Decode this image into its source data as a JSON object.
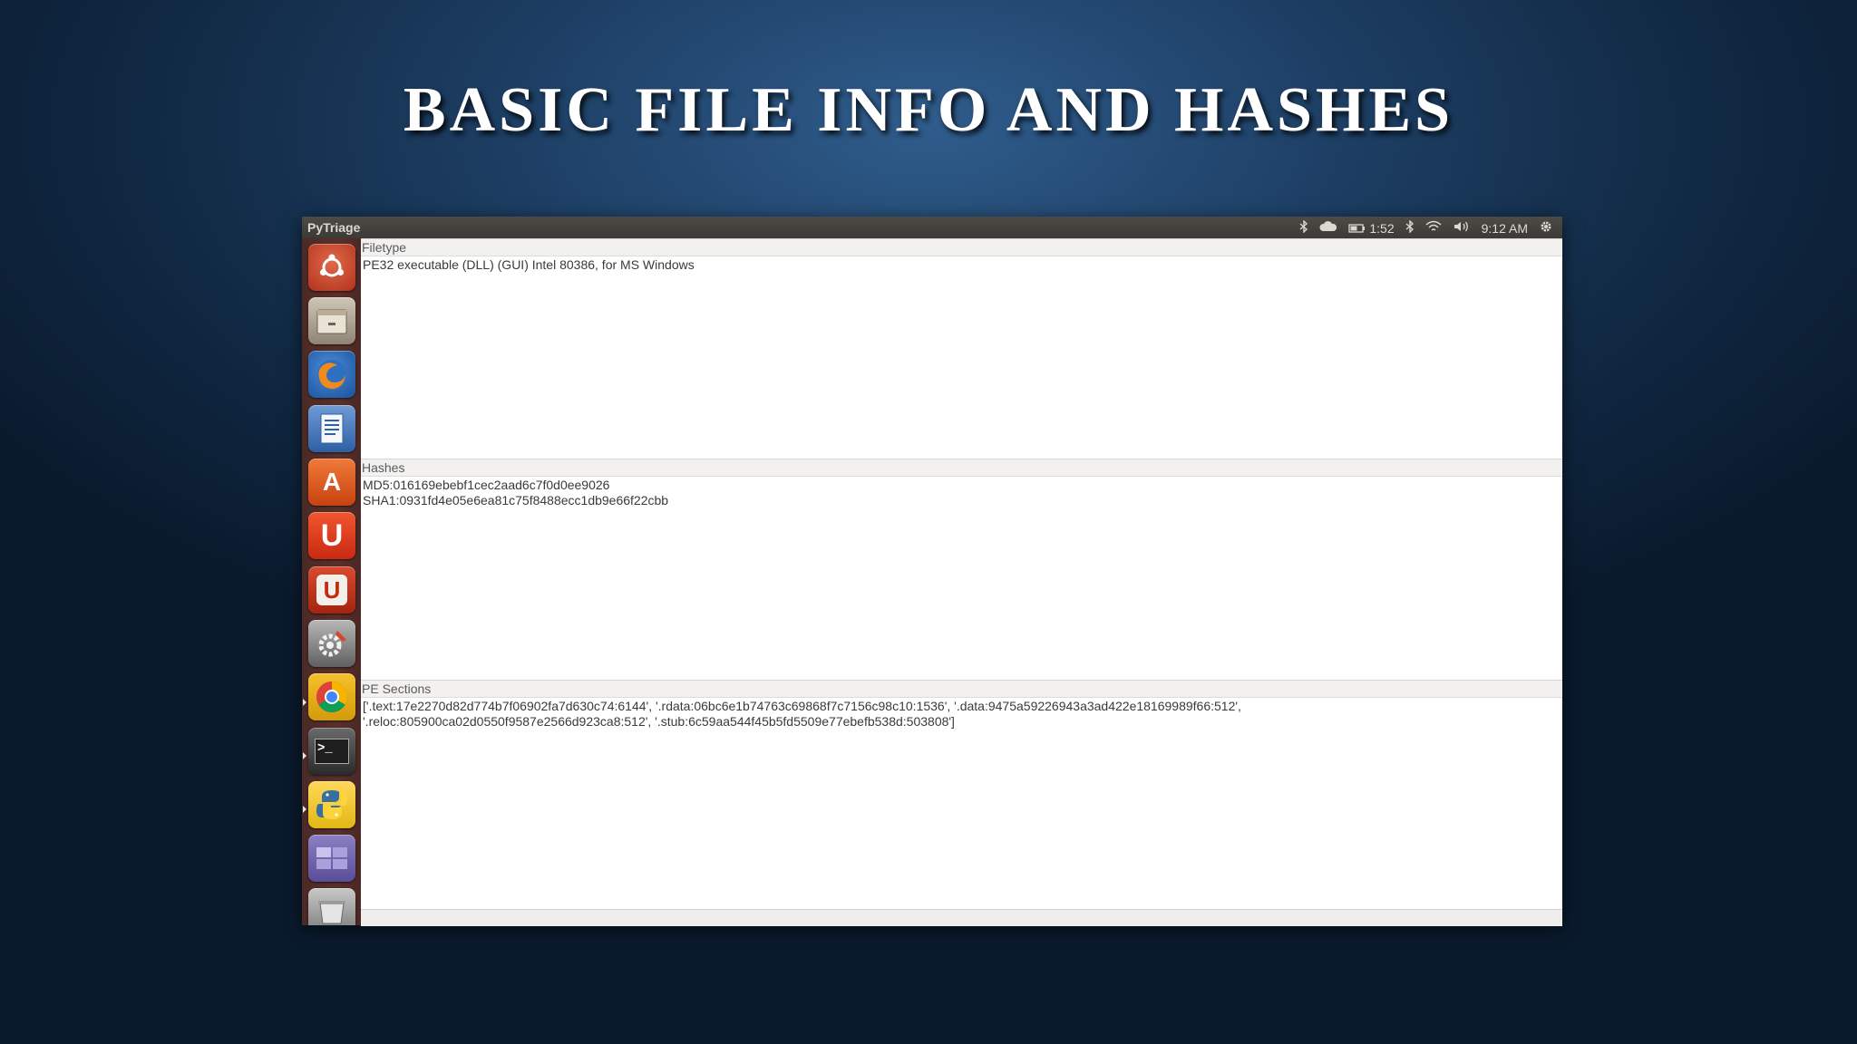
{
  "slide": {
    "title": "BASIC FILE INFO AND HASHES"
  },
  "topbar": {
    "app_name": "PyTriage",
    "battery_time": "1:52",
    "clock": "9:12 AM"
  },
  "launcher": {
    "items": [
      {
        "name": "ubuntu-dash-icon",
        "color": "#c9442a"
      },
      {
        "name": "files-icon",
        "color": "#9a8f7e"
      },
      {
        "name": "firefox-icon",
        "color": "#1b4f9c"
      },
      {
        "name": "writer-icon",
        "color": "#3b6fb7"
      },
      {
        "name": "software-center-icon",
        "color": "#e0531b"
      },
      {
        "name": "ubuntu-one-icon",
        "color": "#d5361a"
      },
      {
        "name": "ubuntu-one-music-icon",
        "color": "#b3301a"
      },
      {
        "name": "system-settings-icon",
        "color": "#7c7c7c"
      },
      {
        "name": "chrome-icon",
        "color": "#e8b80f"
      },
      {
        "name": "terminal-icon",
        "color": "#2c2c2c"
      },
      {
        "name": "python-icon",
        "color": "#3770a0"
      },
      {
        "name": "workspace-switcher-icon",
        "color": "#6d5fa8"
      },
      {
        "name": "trash-icon",
        "color": "#8a8a8a"
      }
    ]
  },
  "filetype": {
    "header": "Filetype",
    "value": "PE32 executable (DLL) (GUI) Intel 80386, for MS Windows"
  },
  "hashes": {
    "header": "Hashes",
    "md5": "MD5:016169ebebf1cec2aad6c7f0d0ee9026",
    "sha1": "SHA1:0931fd4e05e6ea81c75f8488ecc1db9e66f22cbb"
  },
  "pe_sections": {
    "header": "PE Sections",
    "line1": "['.text:17e2270d82d774b7f06902fa7d630c74:6144', '.rdata:06bc6e1b74763c69868f7c7156c98c10:1536', '.data:9475a59226943a3ad422e18169989f66:512',",
    "line2": "'.reloc:805900ca02d0550f9587e2566d923ca8:512', '.stub:6c59aa544f45b5fd5509e77ebefb538d:503808']"
  }
}
